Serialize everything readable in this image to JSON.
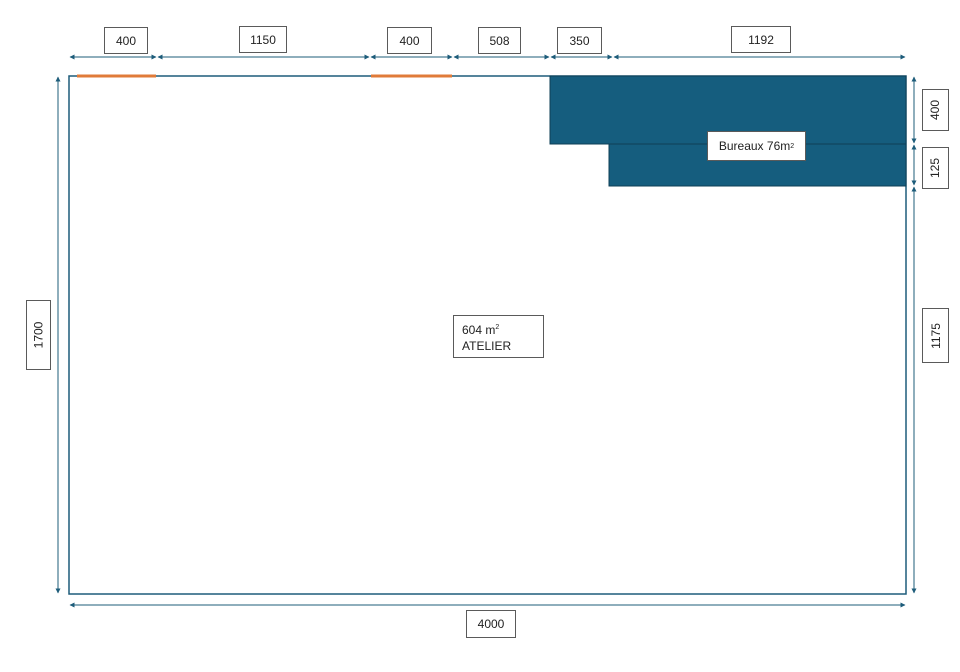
{
  "colors": {
    "wall": "#1d5c7a",
    "office": "#155d7e",
    "opening": "#e07b39",
    "dimension": "#1d5c7a"
  },
  "dimensions": {
    "top": [
      "400",
      "1150",
      "400",
      "508",
      "350",
      "1192"
    ],
    "bottom": "4000",
    "left": "1700",
    "right": [
      "400",
      "125",
      "1175"
    ]
  },
  "rooms": {
    "office": {
      "label": "Bureaux 76m",
      "sup": "2"
    },
    "workshop": {
      "area": "604 m",
      "sup": "2",
      "name": "ATELIER"
    }
  }
}
